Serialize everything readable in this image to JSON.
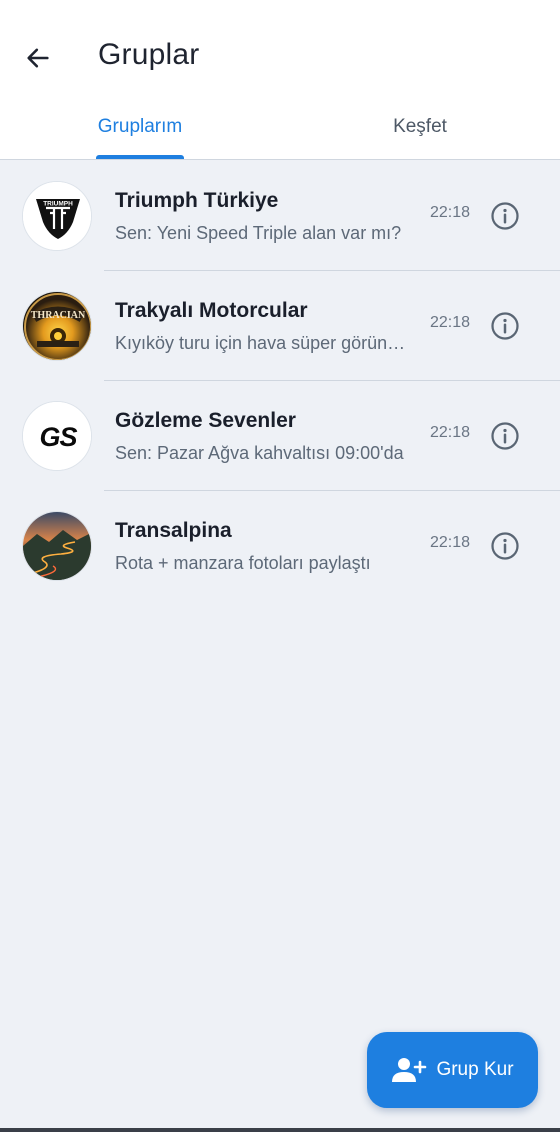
{
  "header": {
    "title": "Gruplar",
    "back_icon": "arrow-left-icon"
  },
  "tabs": [
    {
      "label": "Gruplarım",
      "selected": true
    },
    {
      "label": "Keşfet",
      "selected": false
    }
  ],
  "groups": [
    {
      "name": "Triumph Türkiye",
      "preview": "Sen: Yeni Speed Triple alan var mı?",
      "time": "22:18",
      "avatar": {
        "icon": "triumph-logo-icon",
        "logo_text": "TRIUMPH"
      },
      "info_icon": "info-icon"
    },
    {
      "name": "Trakyalı Motorcular",
      "preview": "Kıyıköy turu için hava süper görünüyor",
      "time": "22:18",
      "avatar": {
        "icon": "thracian-badge-icon",
        "logo_text": "THRACIAN"
      },
      "info_icon": "info-icon"
    },
    {
      "name": "Gözleme Sevenler",
      "preview": "Sen: Pazar Ağva kahvaltısı 09:00'da",
      "time": "22:18",
      "avatar": {
        "icon": "gs-logo-icon",
        "logo_text": "GS"
      },
      "info_icon": "info-icon"
    },
    {
      "name": "Transalpina",
      "preview": "Rota + manzara fotoları paylaştı",
      "time": "22:18",
      "avatar": {
        "icon": "mountain-road-photo-icon",
        "logo_text": ""
      },
      "info_icon": "info-icon"
    }
  ],
  "fab": {
    "label": "Grup Kur",
    "icon": "add-group-icon"
  },
  "colors": {
    "accent": "#1e7fe0",
    "background": "#eef1f6",
    "header_background": "#ffffff",
    "secondary_text": "#5d6978"
  }
}
